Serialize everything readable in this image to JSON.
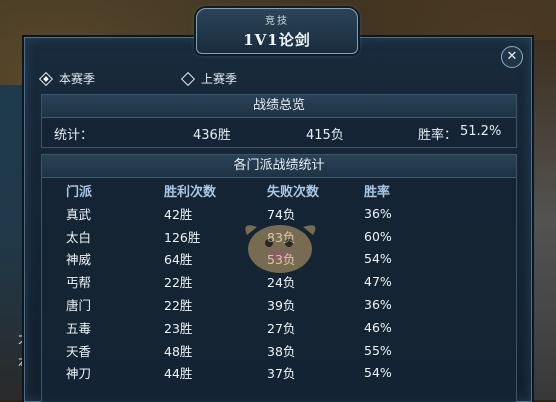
{
  "background": {
    "left_chars": [
      "大",
      "本"
    ]
  },
  "window": {
    "top_label": "竞技",
    "title": "1V1论剑",
    "close_glyph": "✕"
  },
  "season_tabs": [
    {
      "label": "本赛季",
      "selected": true
    },
    {
      "label": "上赛季",
      "selected": false
    }
  ],
  "summary": {
    "heading": "战绩总览",
    "stats_label": "统计：",
    "wins": "436胜",
    "losses": "415负",
    "rate_label": "胜率：",
    "rate_value": "51.2%"
  },
  "detail": {
    "heading": "各门派战绩统计",
    "columns": [
      "门派",
      "胜利次数",
      "失败次数",
      "胜率"
    ],
    "rows": [
      [
        "真武",
        "42胜",
        "74负",
        "36%"
      ],
      [
        "太白",
        "126胜",
        "83负",
        "60%"
      ],
      [
        "神威",
        "64胜",
        "53负",
        "54%"
      ],
      [
        "丐帮",
        "22胜",
        "24负",
        "47%"
      ],
      [
        "唐门",
        "22胜",
        "39负",
        "36%"
      ],
      [
        "五毒",
        "23胜",
        "27负",
        "46%"
      ],
      [
        "天香",
        "48胜",
        "38负",
        "55%"
      ],
      [
        "神刀",
        "44胜",
        "37负",
        "54%"
      ]
    ]
  },
  "colors": {
    "window_bg": "#182a3c",
    "border": "#4d6e88",
    "header_text": "#a9c6e2",
    "body_text": "#eef3f7"
  }
}
